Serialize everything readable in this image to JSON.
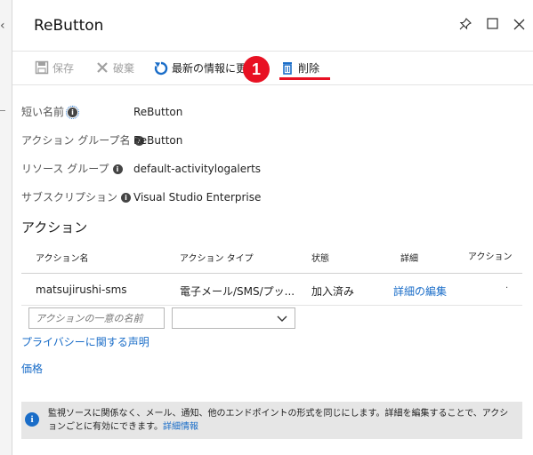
{
  "window": {
    "title": "ReButton"
  },
  "toolbar": {
    "save_label": "保存",
    "discard_label": "破棄",
    "refresh_label": "最新の情報に更新",
    "delete_label": "削除",
    "callout_number": "1"
  },
  "properties": [
    {
      "label": "短い名前",
      "value": "ReButton"
    },
    {
      "label": "アクション グループ名",
      "value": "ReButton"
    },
    {
      "label": "リソース グループ",
      "value": "default-activitylogalerts"
    },
    {
      "label": "サブスクリプション",
      "value": "Visual Studio Enterprise"
    }
  ],
  "actions": {
    "section_title": "アクション",
    "columns": [
      "アクション名",
      "アクション タイプ",
      "状態",
      "詳細",
      "アクション"
    ],
    "rows": [
      {
        "name": "matsujirushi-sms",
        "type": "電子メール/SMS/プッ...",
        "status": "加入済み",
        "details": "詳細の編集",
        "action": "·"
      }
    ],
    "new_name_placeholder": "アクションの一意の名前",
    "new_type_value": ""
  },
  "links": {
    "privacy": "プライバシーに関する声明",
    "pricing": "価格"
  },
  "notice": {
    "text": "監視ソースに関係なく、メール、通知、他のエンドポイントの形式を同じにします。詳細を編集することで、アクションごとに有効にできます。",
    "link": "詳細情報"
  },
  "colors": {
    "accent": "#1a6dc8",
    "highlight": "#e81123"
  }
}
